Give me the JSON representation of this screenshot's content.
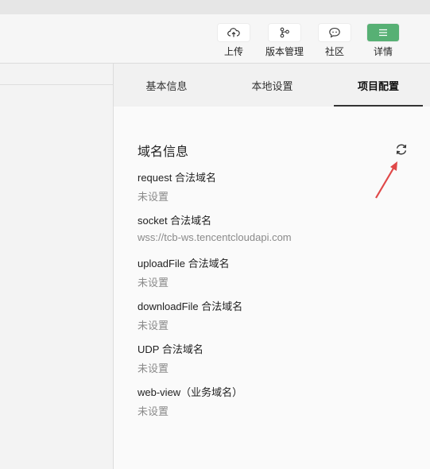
{
  "toolbar": {
    "buttons": [
      {
        "label": "上传",
        "icon": "cloud-upload-icon"
      },
      {
        "label": "版本管理",
        "icon": "branch-icon"
      },
      {
        "label": "社区",
        "icon": "chat-bubble-icon"
      },
      {
        "label": "详情",
        "icon": "menu-icon"
      }
    ],
    "accent": "#57b074"
  },
  "tabs": [
    {
      "label": "基本信息",
      "active": false
    },
    {
      "label": "本地设置",
      "active": false
    },
    {
      "label": "项目配置",
      "active": true
    }
  ],
  "domain_section": {
    "title": "域名信息",
    "refresh_icon": "refresh-icon",
    "items": [
      {
        "name": "request 合法域名",
        "value": "未设置"
      },
      {
        "name": "socket 合法域名",
        "value": "wss://tcb-ws.tencentcloudapi.com"
      },
      {
        "name": "uploadFile 合法域名",
        "value": "未设置"
      },
      {
        "name": "downloadFile 合法域名",
        "value": "未设置"
      },
      {
        "name": "UDP 合法域名",
        "value": "未设置"
      },
      {
        "name": "web-view（业务域名）",
        "value": "未设置"
      }
    ]
  },
  "annotation": {
    "color": "#e04848",
    "icon": "arrow-annotation-icon"
  }
}
